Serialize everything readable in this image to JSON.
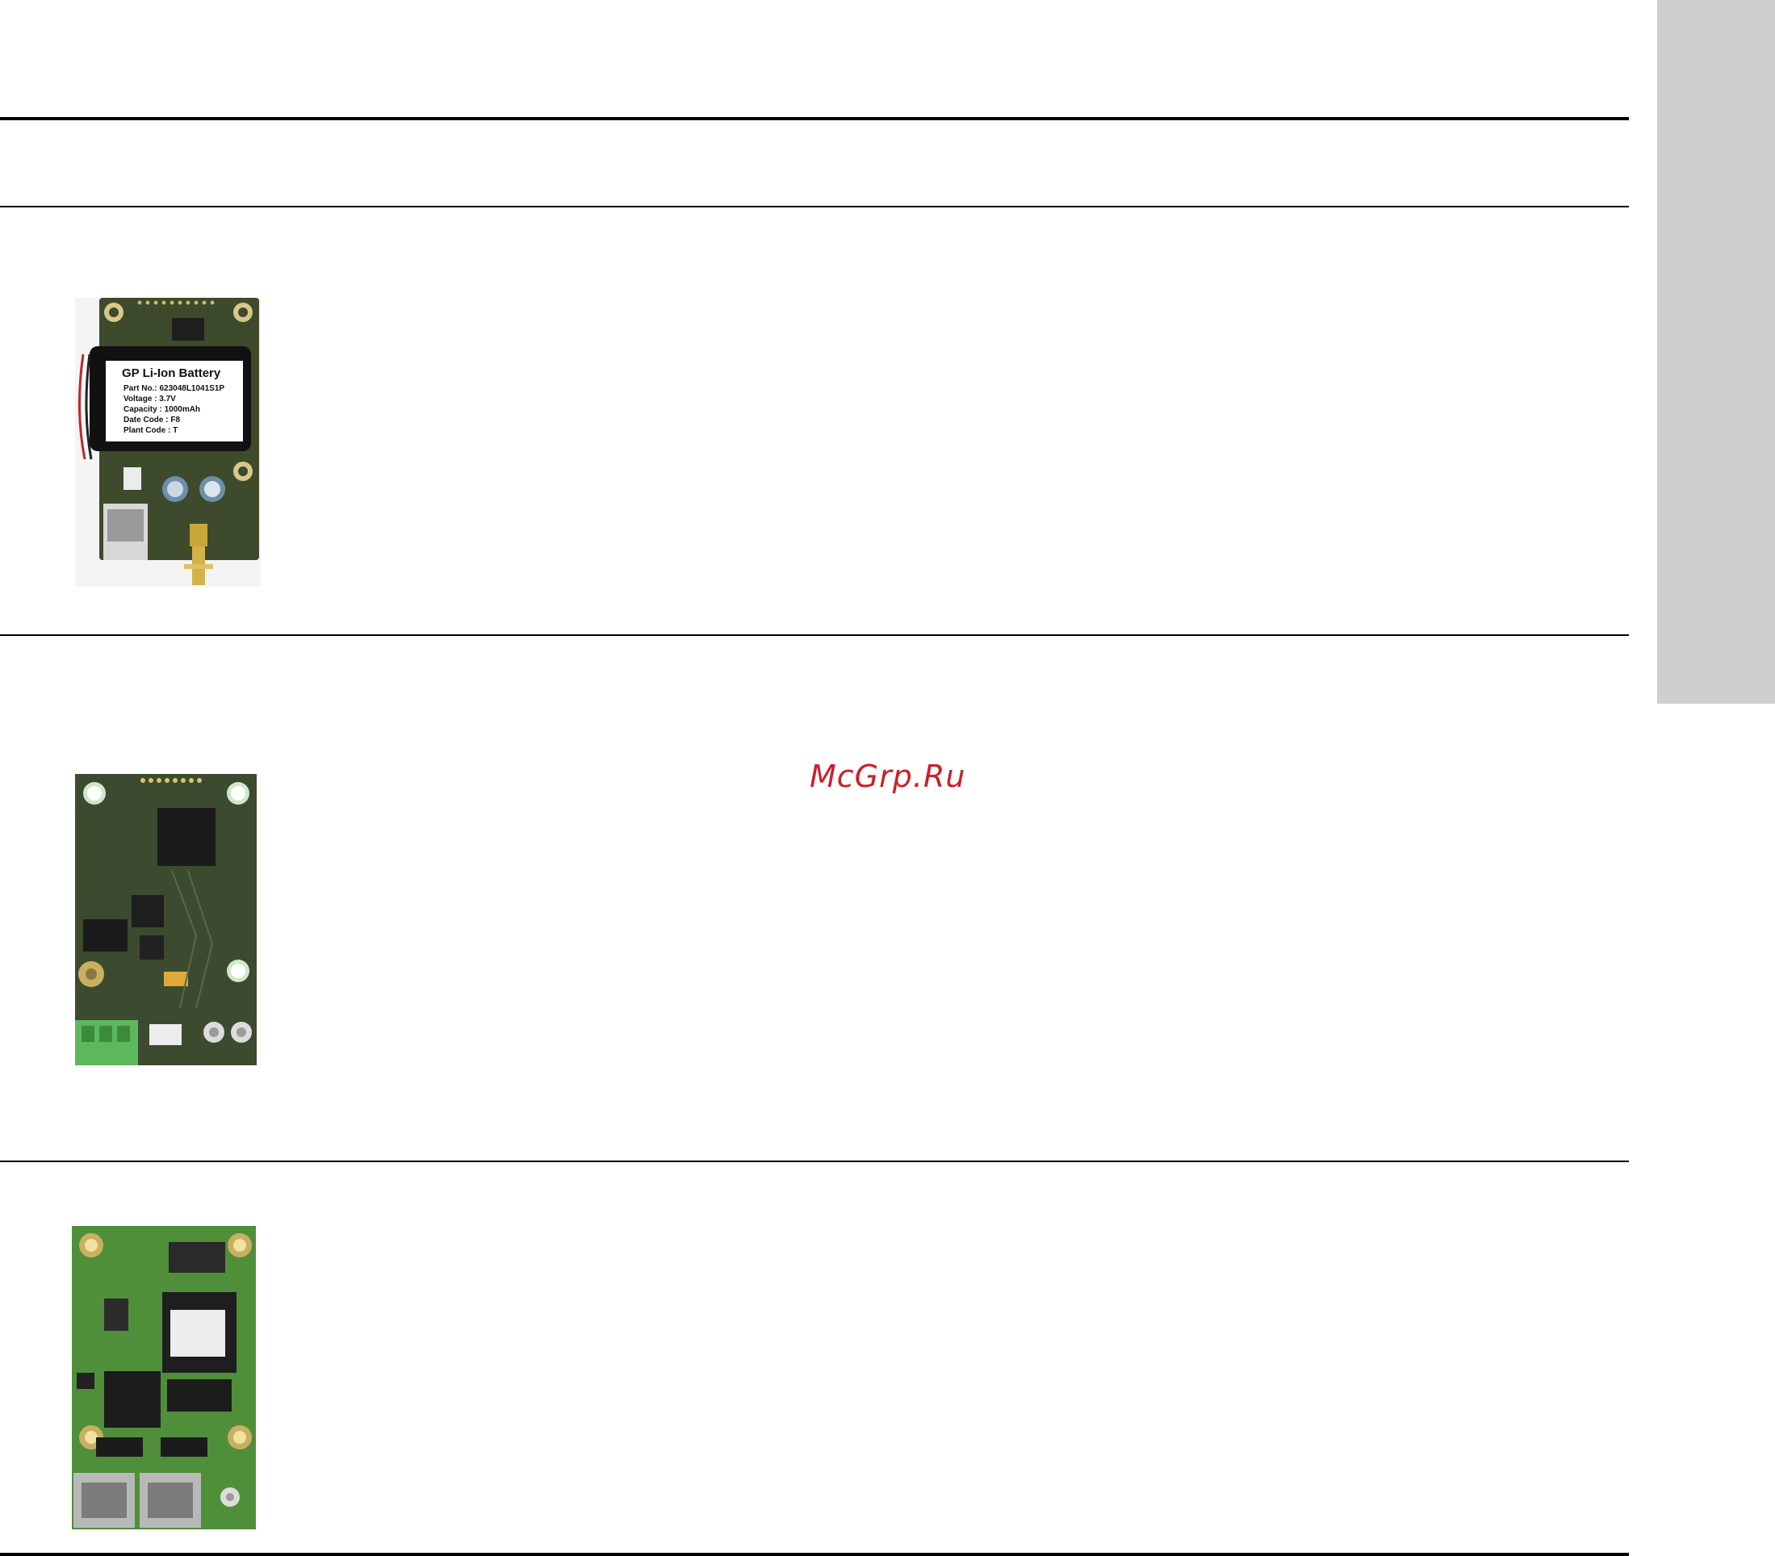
{
  "watermark": {
    "text": "McGrp.Ru",
    "color": "#c8202a"
  },
  "battery_label": {
    "title": "GP Li-Ion Battery",
    "line1": "Part No.: 623048L1041S1P",
    "line2": "Voltage      : 3.7V",
    "line3": "Capacity     : 1000mAh",
    "line4": "Date Code :  F8",
    "line5": "Plant Code : T"
  },
  "colors": {
    "side_tab": "#cfcfcf",
    "pcb_dark": "#3d4a2c",
    "pcb_green": "#4f8f3a",
    "terminal_green": "#5cb85c"
  }
}
